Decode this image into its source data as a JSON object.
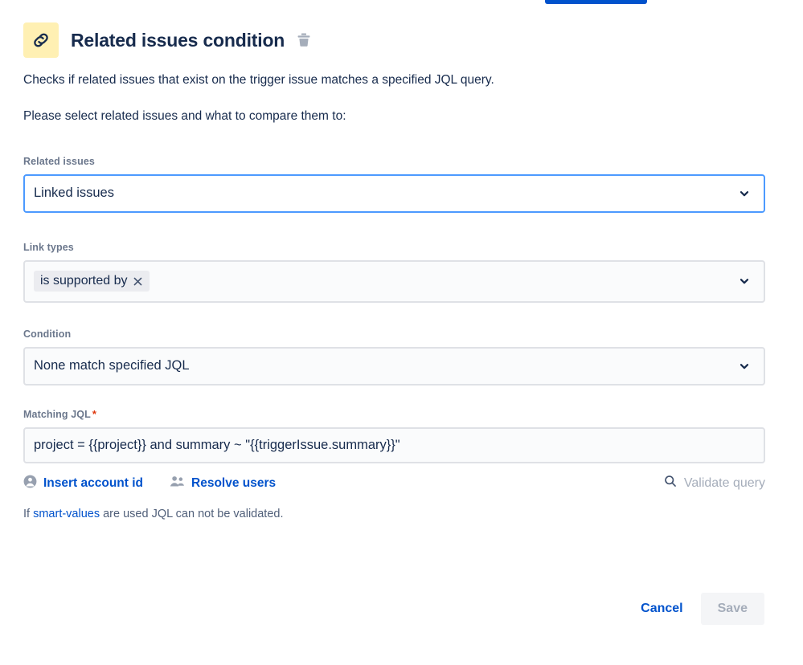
{
  "top_cut_button": {
    "color": "#0052cc"
  },
  "header": {
    "icon": "link-chain-icon",
    "icon_bg": "#fff0b3",
    "title": "Related issues condition",
    "delete_icon": "trash-icon"
  },
  "description": {
    "line1": "Checks if related issues that exist on the trigger issue matches a specified JQL query.",
    "line2": "Please select related issues and what to compare them to:"
  },
  "fields": {
    "related_issues": {
      "label": "Related issues",
      "value": "Linked issues",
      "focused": true,
      "focus_color": "#4c9aff",
      "chevron_icon": "chevron-down-icon"
    },
    "link_types": {
      "label": "Link types",
      "chips": [
        {
          "label": "is supported by",
          "remove_icon": "close-icon"
        }
      ],
      "chevron_icon": "chevron-down-icon"
    },
    "condition": {
      "label": "Condition",
      "value": "None match specified JQL",
      "chevron_icon": "chevron-down-icon"
    },
    "matching_jql": {
      "label": "Matching JQL",
      "required_marker": "*",
      "value": "project = {{project}} and summary ~ \"{{triggerIssue.summary}}\""
    }
  },
  "jql_actions": {
    "insert_account_id": {
      "label": "Insert account id",
      "icon": "person-icon"
    },
    "resolve_users": {
      "label": "Resolve users",
      "icon": "people-group-icon"
    },
    "validate_query": {
      "label": "Validate query",
      "icon": "search-icon",
      "disabled": true
    }
  },
  "note": {
    "prefix": "If ",
    "link": "smart-values",
    "suffix": " are used JQL can not be validated."
  },
  "footer": {
    "cancel_label": "Cancel",
    "save_label": "Save",
    "save_disabled": true
  },
  "colors": {
    "text": "#172b4d",
    "label": "#6b778c",
    "link": "#0052cc",
    "border": "#dfe1e6",
    "field_bg": "#fafbfc",
    "chip_bg": "#ebecf0",
    "disabled_text": "#a5adba",
    "required": "#de350b"
  }
}
